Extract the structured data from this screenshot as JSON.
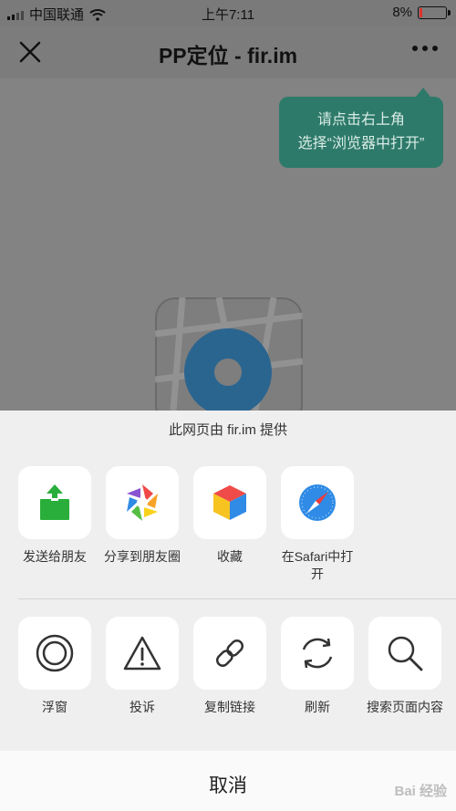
{
  "status_bar": {
    "carrier": "中国联通",
    "time": "上午7:11",
    "battery": "8%"
  },
  "nav": {
    "title": "PP定位 - fir.im"
  },
  "tooltip": {
    "line1": "请点击右上角",
    "line2": "选择“浏览器中打开”"
  },
  "sheet": {
    "header": "此网页由 fir.im 提供",
    "row1": [
      {
        "label": "发送给朋友",
        "icon": "share-upload-icon"
      },
      {
        "label": "分享到朋友圈",
        "icon": "moments-aperture-icon"
      },
      {
        "label": "收藏",
        "icon": "favorite-cube-icon"
      },
      {
        "label": "在Safari中打开",
        "icon": "safari-compass-icon"
      }
    ],
    "row2": [
      {
        "label": "浮窗",
        "icon": "float-window-icon"
      },
      {
        "label": "投诉",
        "icon": "warning-icon"
      },
      {
        "label": "复制链接",
        "icon": "link-icon"
      },
      {
        "label": "刷新",
        "icon": "refresh-icon"
      },
      {
        "label": "搜索页面内容",
        "icon": "search-icon"
      }
    ],
    "cancel": "取消"
  },
  "watermark": "Bai 经验",
  "colors": {
    "tooltip_bg": "#2e7a6a",
    "share_green": "#2aae3b",
    "safari_blue": "#2f8be6"
  }
}
